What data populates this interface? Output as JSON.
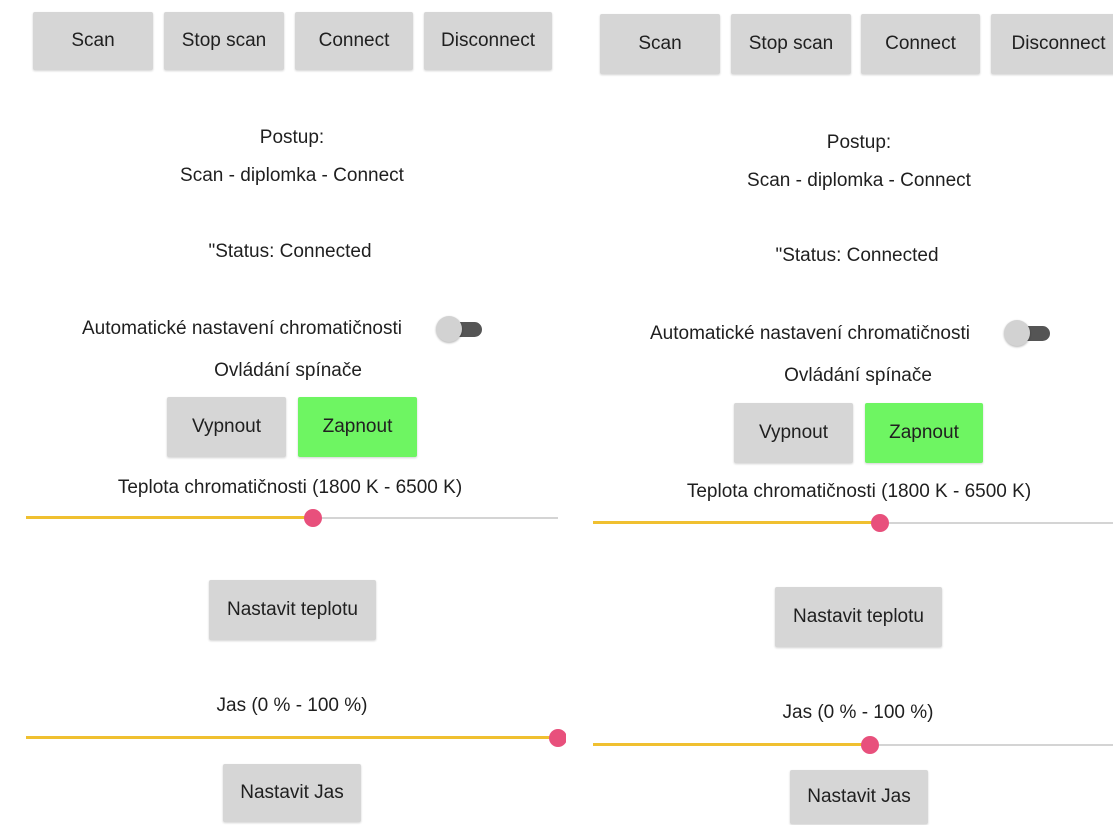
{
  "panels": [
    {
      "toolbar": {
        "scan": "Scan",
        "stop_scan": "Stop scan",
        "connect": "Connect",
        "disconnect": "Disconnect"
      },
      "procedure_title": "Postup:",
      "procedure_steps": "Scan - diplomka - Connect",
      "status": "\"Status: Connected",
      "auto_chroma_label": "Automatické nastavení chromatičnosti",
      "auto_chroma_on": false,
      "switch_title": "Ovládání spínače",
      "off_button": "Vypnout",
      "on_button": "Zapnout",
      "temperature_label": "Teplota chromatičnosti (1800 K - 6500 K)",
      "temperature_fraction": 0.54,
      "set_temperature_button": "Nastavit teplotu",
      "brightness_label": "Jas (0 % - 100 %)",
      "brightness_fraction": 1.0,
      "set_brightness_button": "Nastavit Jas"
    },
    {
      "toolbar": {
        "scan": "Scan",
        "stop_scan": "Stop scan",
        "connect": "Connect",
        "disconnect": "Disconnect"
      },
      "procedure_title": "Postup:",
      "procedure_steps": "Scan - diplomka - Connect",
      "status": "\"Status: Connected",
      "auto_chroma_label": "Automatické nastavení chromatičnosti",
      "auto_chroma_on": false,
      "switch_title": "Ovládání spínače",
      "off_button": "Vypnout",
      "on_button": "Zapnout",
      "temperature_label": "Teplota chromatičnosti (1800 K - 6500 K)",
      "temperature_fraction": 0.54,
      "set_temperature_button": "Nastavit teplotu",
      "brightness_label": "Jas (0 % - 100 %)",
      "brightness_fraction": 0.52,
      "set_brightness_button": "Nastavit Jas"
    }
  ],
  "colors": {
    "button_bg": "#d6d6d6",
    "on_button_bg": "#6ef562",
    "slider_fill": "#f0c030",
    "slider_thumb": "#e8507c",
    "slider_track": "#d4d4d4"
  }
}
